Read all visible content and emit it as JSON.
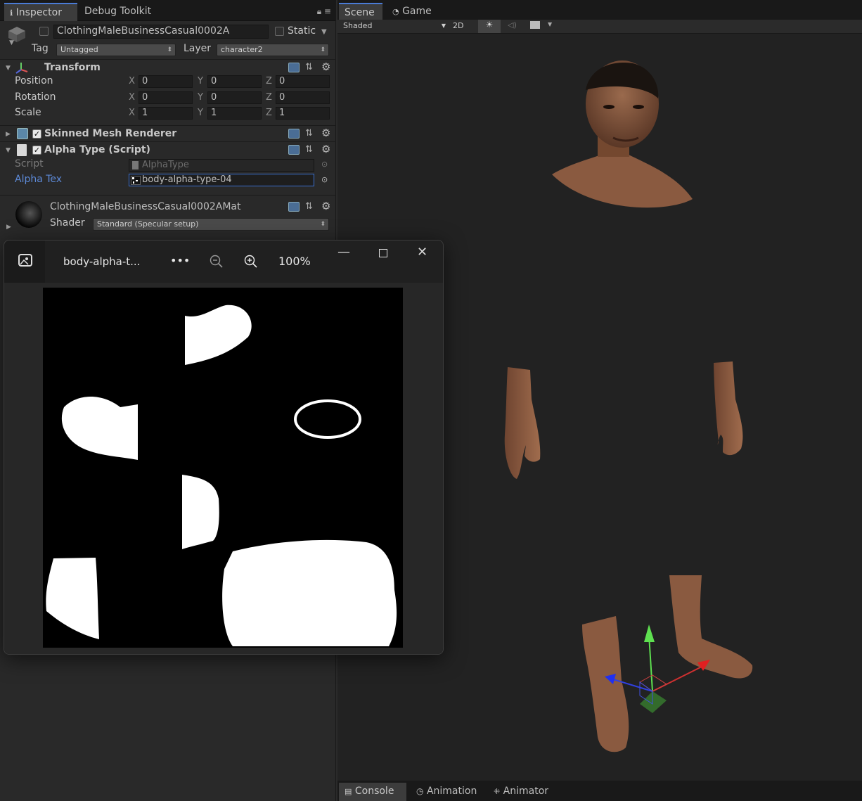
{
  "inspector": {
    "tabs": [
      "Inspector",
      "Debug Toolkit"
    ],
    "object_name": "ClothingMaleBusinessCasual0002A",
    "static_label": "Static",
    "tag_label": "Tag",
    "tag_value": "Untagged",
    "layer_label": "Layer",
    "layer_value": "character2",
    "transform": {
      "title": "Transform",
      "position_label": "Position",
      "rotation_label": "Rotation",
      "scale_label": "Scale",
      "axis_x": "X",
      "axis_y": "Y",
      "axis_z": "Z",
      "position": [
        "0",
        "0",
        "0"
      ],
      "rotation": [
        "0",
        "0",
        "0"
      ],
      "scale": [
        "1",
        "1",
        "1"
      ]
    },
    "skinned_mesh": {
      "title": "Skinned Mesh Renderer",
      "enabled": true
    },
    "alpha_type": {
      "title": "Alpha Type (Script)",
      "enabled": true,
      "script_label": "Script",
      "script_value": "AlphaType",
      "alpha_tex_label": "Alpha Tex",
      "alpha_tex_value": "body-alpha-type-04"
    },
    "material": {
      "name": "ClothingMaleBusinessCasual0002AMat",
      "shader_label": "Shader",
      "shader_value": "Standard (Specular setup)"
    }
  },
  "viewer": {
    "file_name": "body-alpha-t...",
    "more": "•••",
    "zoom": "100%"
  },
  "scene": {
    "tabs": [
      "Scene",
      "Game"
    ],
    "shading": "Shaded",
    "mode_2d": "2D",
    "bottom_tabs": [
      "Console",
      "Animation",
      "Animator"
    ]
  },
  "colors": {
    "accent": "#4a7bd5",
    "skin": "#8a5a3e"
  }
}
